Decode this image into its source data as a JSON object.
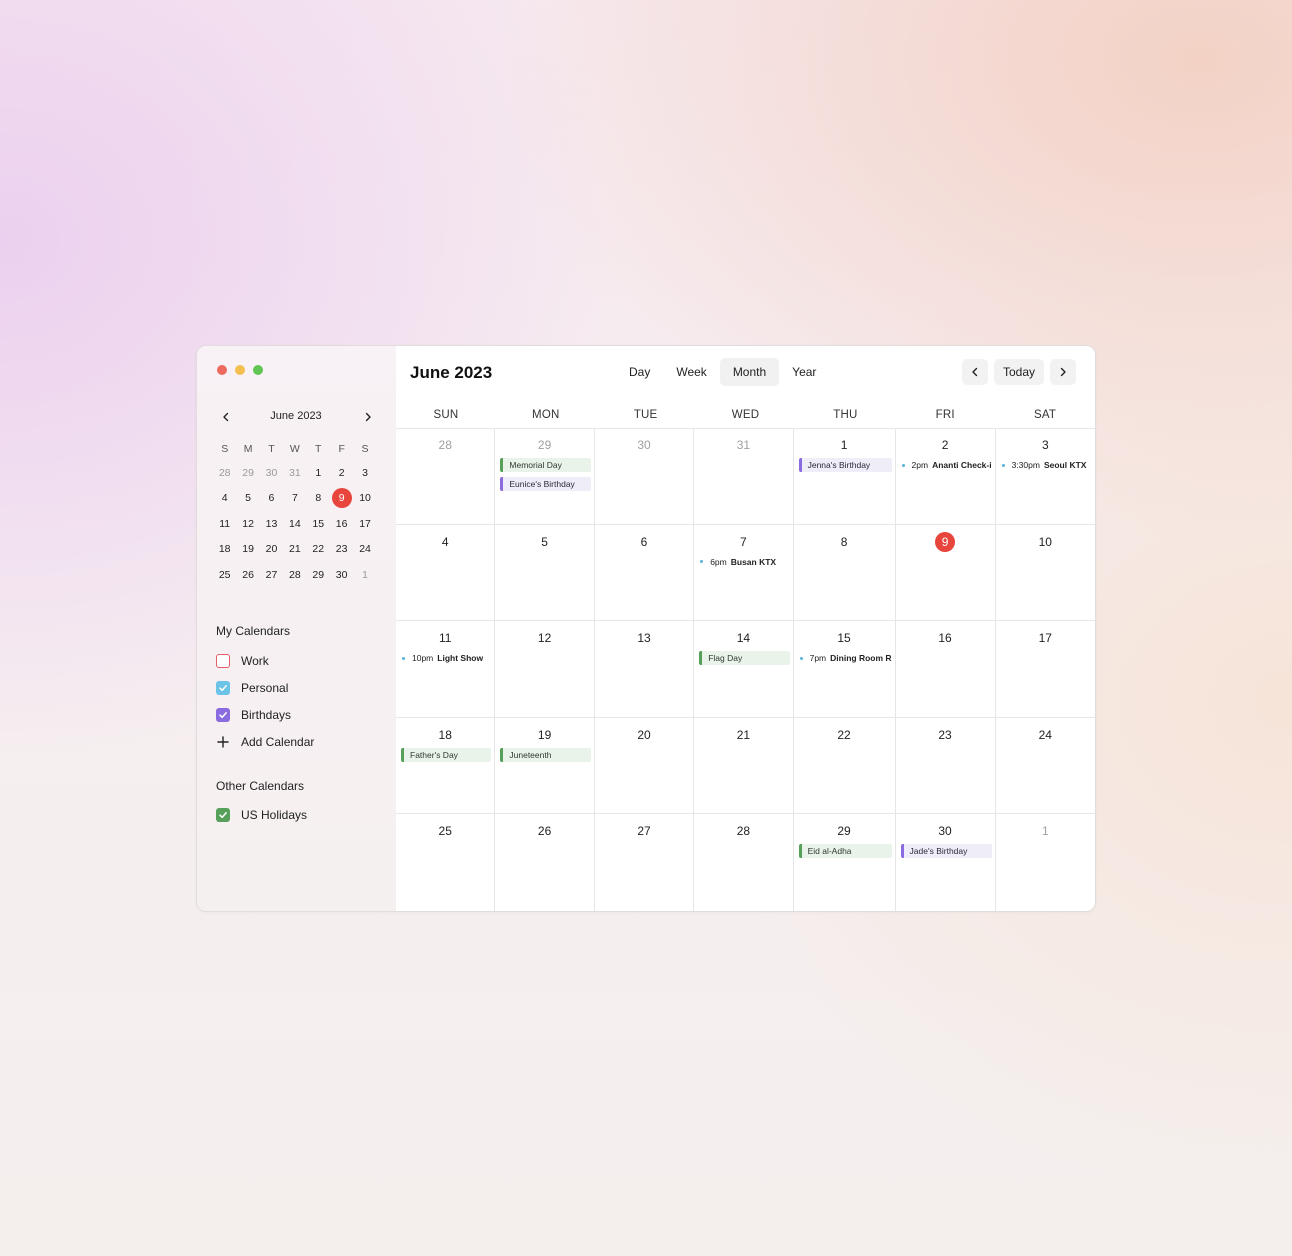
{
  "colors": {
    "accent_today": "#e8453c",
    "work": "#e55d66",
    "personal": "#6cc3e8",
    "birthdays": "#8a6ce0",
    "holidays": "#57a05a",
    "timed_dot": "#5ab4d8"
  },
  "mini": {
    "title": "June 2023",
    "dow": [
      "S",
      "M",
      "T",
      "W",
      "T",
      "F",
      "S"
    ],
    "weeks": [
      [
        {
          "d": "28",
          "m": true
        },
        {
          "d": "29",
          "m": true
        },
        {
          "d": "30",
          "m": true
        },
        {
          "d": "31",
          "m": true
        },
        {
          "d": "1"
        },
        {
          "d": "2"
        },
        {
          "d": "3"
        }
      ],
      [
        {
          "d": "4"
        },
        {
          "d": "5"
        },
        {
          "d": "6"
        },
        {
          "d": "7"
        },
        {
          "d": "8"
        },
        {
          "d": "9",
          "today": true
        },
        {
          "d": "10"
        }
      ],
      [
        {
          "d": "11"
        },
        {
          "d": "12"
        },
        {
          "d": "13"
        },
        {
          "d": "14"
        },
        {
          "d": "15"
        },
        {
          "d": "16"
        },
        {
          "d": "17"
        }
      ],
      [
        {
          "d": "18"
        },
        {
          "d": "19"
        },
        {
          "d": "20"
        },
        {
          "d": "21"
        },
        {
          "d": "22"
        },
        {
          "d": "23"
        },
        {
          "d": "24"
        }
      ],
      [
        {
          "d": "25"
        },
        {
          "d": "26"
        },
        {
          "d": "27"
        },
        {
          "d": "28"
        },
        {
          "d": "29"
        },
        {
          "d": "30"
        },
        {
          "d": "1",
          "m": true
        }
      ]
    ]
  },
  "my_calendars": {
    "title": "My Calendars",
    "items": [
      {
        "label": "Work",
        "checked": false,
        "color": "#e55d66"
      },
      {
        "label": "Personal",
        "checked": true,
        "color": "#6cc3e8"
      },
      {
        "label": "Birthdays",
        "checked": true,
        "color": "#8a6ce0"
      }
    ],
    "add_label": "Add Calendar"
  },
  "other_calendars": {
    "title": "Other Calendars",
    "items": [
      {
        "label": "US Holidays",
        "checked": true,
        "color": "#57a05a"
      }
    ]
  },
  "header": {
    "title": "June 2023",
    "views": [
      {
        "label": "Day",
        "active": false
      },
      {
        "label": "Week",
        "active": false
      },
      {
        "label": "Month",
        "active": true
      },
      {
        "label": "Year",
        "active": false
      }
    ],
    "today_label": "Today"
  },
  "month": {
    "dow": [
      "SUN",
      "MON",
      "TUE",
      "WED",
      "THU",
      "FRI",
      "SAT"
    ],
    "days": [
      {
        "d": "28",
        "m": true,
        "events": []
      },
      {
        "d": "29",
        "m": true,
        "events": [
          {
            "kind": "bar",
            "color": "green",
            "name": "Memorial Day"
          },
          {
            "kind": "bar",
            "color": "purple",
            "name": "Eunice's Birthday"
          }
        ]
      },
      {
        "d": "30",
        "m": true,
        "events": []
      },
      {
        "d": "31",
        "m": true,
        "events": []
      },
      {
        "d": "1",
        "events": [
          {
            "kind": "bar",
            "color": "purple",
            "name": "Jenna's Birthday"
          }
        ]
      },
      {
        "d": "2",
        "events": [
          {
            "kind": "timed",
            "time": "2pm",
            "name": "Ananti Check-i"
          }
        ]
      },
      {
        "d": "3",
        "events": [
          {
            "kind": "timed",
            "time": "3:30pm",
            "name": "Seoul KTX"
          }
        ]
      },
      {
        "d": "4",
        "events": []
      },
      {
        "d": "5",
        "events": []
      },
      {
        "d": "6",
        "events": []
      },
      {
        "d": "7",
        "events": [
          {
            "kind": "timed",
            "time": "6pm",
            "name": "Busan KTX"
          }
        ]
      },
      {
        "d": "8",
        "events": []
      },
      {
        "d": "9",
        "today": true,
        "events": []
      },
      {
        "d": "10",
        "events": []
      },
      {
        "d": "11",
        "events": [
          {
            "kind": "timed",
            "time": "10pm",
            "name": "Light Show"
          }
        ]
      },
      {
        "d": "12",
        "events": []
      },
      {
        "d": "13",
        "events": []
      },
      {
        "d": "14",
        "events": [
          {
            "kind": "bar",
            "color": "green",
            "name": "Flag Day"
          }
        ]
      },
      {
        "d": "15",
        "events": [
          {
            "kind": "timed",
            "time": "7pm",
            "name": "Dining Room R"
          }
        ]
      },
      {
        "d": "16",
        "events": []
      },
      {
        "d": "17",
        "events": []
      },
      {
        "d": "18",
        "events": [
          {
            "kind": "bar",
            "color": "green",
            "name": "Father's Day"
          }
        ]
      },
      {
        "d": "19",
        "events": [
          {
            "kind": "bar",
            "color": "green",
            "name": "Juneteenth"
          }
        ]
      },
      {
        "d": "20",
        "events": []
      },
      {
        "d": "21",
        "events": []
      },
      {
        "d": "22",
        "events": []
      },
      {
        "d": "23",
        "events": []
      },
      {
        "d": "24",
        "events": []
      },
      {
        "d": "25",
        "events": []
      },
      {
        "d": "26",
        "events": []
      },
      {
        "d": "27",
        "events": []
      },
      {
        "d": "28",
        "events": []
      },
      {
        "d": "29",
        "events": [
          {
            "kind": "bar",
            "color": "green",
            "name": "Eid al-Adha"
          }
        ]
      },
      {
        "d": "30",
        "events": [
          {
            "kind": "bar",
            "color": "purple",
            "name": "Jade's Birthday"
          }
        ]
      },
      {
        "d": "1",
        "m": true,
        "events": []
      }
    ]
  }
}
